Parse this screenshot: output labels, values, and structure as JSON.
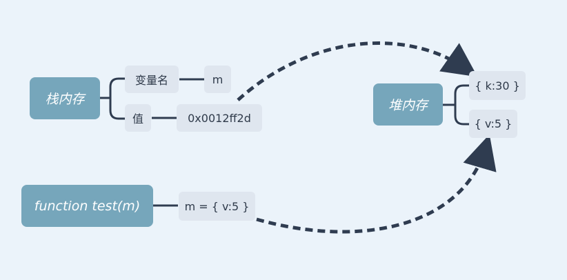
{
  "nodes": {
    "stack_memory": "栈内存",
    "variable_name": "变量名",
    "variable_name_value": "m",
    "value": "值",
    "value_address": "0x0012ff2d",
    "heap_memory": "堆内存",
    "heap_obj_k": "{ k:30 }",
    "heap_obj_v": "{ v:5 }",
    "function_test": "function test(m)",
    "function_param": "m = { v:5 }"
  },
  "colors": {
    "background": "#ebf3fa",
    "main_node": "#76a6bb",
    "sub_node": "#dfe6ef",
    "line": "#2f3c50",
    "text_dark": "#2f3a4a",
    "text_light": "#ffffff"
  }
}
